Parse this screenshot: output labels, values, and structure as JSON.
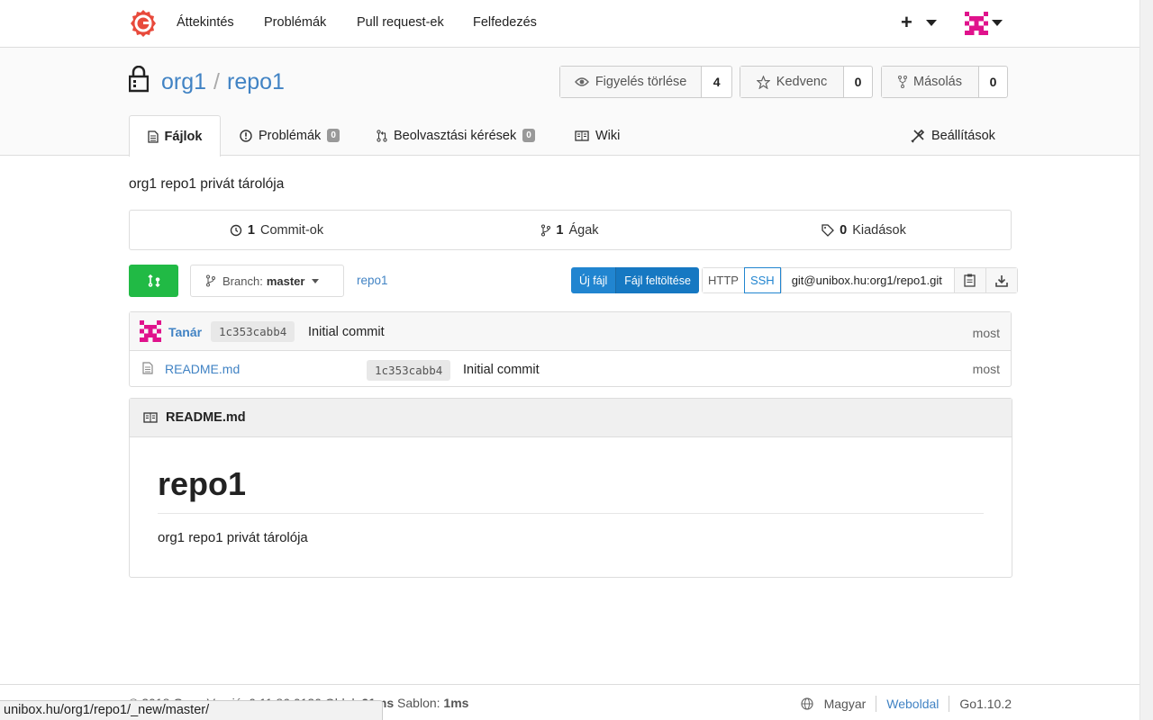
{
  "nav": {
    "items": [
      "Áttekintés",
      "Problémák",
      "Pull request-ek",
      "Felfedezés"
    ],
    "plus": "+"
  },
  "repo": {
    "owner": "org1",
    "separator": "/",
    "name": "repo1",
    "watch": {
      "label": "Figyelés törlése",
      "count": "4"
    },
    "star": {
      "label": "Kedvenc",
      "count": "0"
    },
    "fork": {
      "label": "Másolás",
      "count": "0"
    }
  },
  "tabs": {
    "files": "Fájlok",
    "issues": "Problémák",
    "issues_count": "0",
    "pulls": "Beolvasztási kérések",
    "pulls_count": "0",
    "wiki": "Wiki",
    "settings": "Beállítások"
  },
  "description": "org1 repo1 privát tárolója",
  "stats": {
    "commits_count": "1",
    "commits_label": "Commit-ok",
    "branches_count": "1",
    "branches_label": "Ágak",
    "releases_count": "0",
    "releases_label": "Kiadások"
  },
  "toolbar": {
    "branch_prefix": "Branch:",
    "branch": "master",
    "breadcrumb": "repo1",
    "new_file": "Új fájl",
    "upload": "Fájl feltöltése",
    "http": "HTTP",
    "ssh": "SSH",
    "clone_url": "git@unibox.hu:org1/repo1.git"
  },
  "latest_commit": {
    "author": "Tanár",
    "sha": "1c353cabb4",
    "message": "Initial commit",
    "time": "most"
  },
  "files": [
    {
      "name": "README.md",
      "sha": "1c353cabb4",
      "message": "Initial commit",
      "time": "most"
    }
  ],
  "readme": {
    "filename": "README.md",
    "heading": "repo1",
    "body": "org1 repo1 privát tárolója"
  },
  "footer": {
    "left_1": "© 2018 Gogs Verzió: 0.11.86.0130 Oldal: ",
    "page_time": "21ms",
    "left_2": " Sablon: ",
    "tpl_time": "1ms",
    "language": "Magyar",
    "website": "Weboldal",
    "go_version": "Go1.10.2"
  },
  "statusbar": "unibox.hu/org1/repo1/_new/master/",
  "colors": {
    "link": "#4183c4",
    "primary": "#2185d0",
    "green": "#21ba45",
    "avatar": "#e0128c"
  }
}
